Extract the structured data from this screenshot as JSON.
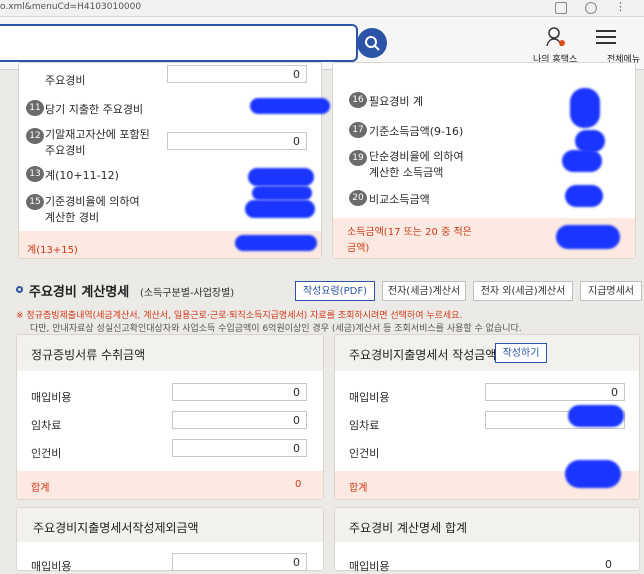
{
  "browser": {
    "url": "o.xml&menuCd=H4103010000"
  },
  "header": {
    "my_home_tax": "나의 홈택스",
    "full_menu": "전체메뉴"
  },
  "left_summary": {
    "row_top": {
      "label": "주요경비",
      "value": "0"
    },
    "rows": [
      {
        "num": "11",
        "label": "당기 지출한 주요경비"
      },
      {
        "num": "12",
        "label1": "기말재고자산에 포함된",
        "label2": "주요경비",
        "value": "0"
      },
      {
        "num": "13",
        "label": "계(10+11-12)"
      },
      {
        "num": "15",
        "label1": "기준경비율에 의하여",
        "label2": "계산한 경비"
      }
    ],
    "total_label": "계(13+15)"
  },
  "right_summary": {
    "rows": [
      {
        "num": "16",
        "label": "필요경비 계"
      },
      {
        "num": "17",
        "label": "기준소득금액(9-16)"
      },
      {
        "num": "19",
        "label1": "단순경비율에 의하여",
        "label2": "계산한 소득금액"
      },
      {
        "num": "20",
        "label": "비교소득금액"
      }
    ],
    "income_label1": "소득금액(17 또는 20 중 적은",
    "income_label2": "금액)"
  },
  "section": {
    "title": "주요경비 계산명세",
    "subtitle": "(소득구분별-사업장별)",
    "btn_guide": "작성요령(PDF)",
    "btn_e_invoice": "전자(세금)계산서",
    "btn_non_e": "전자 외(세금)계산서",
    "btn_pay": "지급명세서",
    "note1": "※ 정규증빙제출내역(세금계산서, 계산서, 일용근로·근로·퇴직소득지급명세서) 자료를 조회하시려면 선택하여 누르세요.",
    "note2": "다만, 안내자료상 성실신고확인대상자와 사업소득 수입금액이 6억원이상인 경우 (세금)계산서 등 조회서비스를 사용할 수 없습니다."
  },
  "card_regular": {
    "title": "정규증빙서류 수취금액",
    "rows": [
      {
        "label": "매입비용",
        "value": "0"
      },
      {
        "label": "임차료",
        "value": "0"
      },
      {
        "label": "인건비",
        "value": "0"
      }
    ],
    "total_label": "합계",
    "total_value": "0"
  },
  "card_statement": {
    "title": "주요경비지출명세서 작성금액",
    "write_btn": "작성하기",
    "rows": [
      {
        "label": "매입비용",
        "value": "0"
      },
      {
        "label": "임차료",
        "value": ""
      },
      {
        "label": "인건비",
        "value": ""
      }
    ],
    "total_label": "합계"
  },
  "card_excluded": {
    "title": "주요경비지출명세서작성제외금액",
    "row_label": "매입비용",
    "row_value": "0"
  },
  "card_sum": {
    "title": "주요경비 계산명세 합계",
    "row_label": "매입비용",
    "row_value": "0"
  },
  "colors": {
    "accent": "#2b53a8",
    "total_red": "#cc3a16",
    "redaction": "#1a35ff"
  }
}
